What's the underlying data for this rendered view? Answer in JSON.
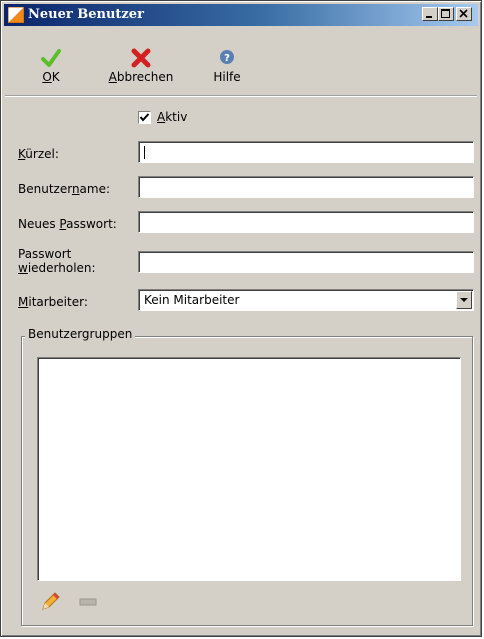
{
  "window": {
    "title": "Neuer Benutzer",
    "minimize_icon": "minimize-icon",
    "maximize_icon": "maximize-icon",
    "close_icon": "close-icon"
  },
  "toolbar": {
    "ok": {
      "label_u": "O",
      "label_rest": "K",
      "icon": "checkmark-icon",
      "color": "#5cbf2a"
    },
    "cancel": {
      "label_u": "A",
      "label_rest": "bbrechen",
      "icon": "red-x-icon",
      "color": "#d42020"
    },
    "help": {
      "label": "Hilfe",
      "icon": "question-icon",
      "color": "#5a7fb5"
    }
  },
  "form": {
    "active": {
      "label_u": "A",
      "label_rest": "ktiv",
      "checked": true
    },
    "kuerzel": {
      "label_u": "K",
      "label_rest": "ürzel:",
      "value": ""
    },
    "username": {
      "label_pre": "Benutzer",
      "label_u": "n",
      "label_rest": "ame:",
      "value": ""
    },
    "new_password": {
      "label_pre": "Neues ",
      "label_u": "P",
      "label_rest": "asswort:",
      "value": ""
    },
    "repeat_password": {
      "label_line1": "Passwort",
      "label_u": "w",
      "label_rest": "iederholen:",
      "value": ""
    },
    "employee": {
      "label_u": "M",
      "label_rest": "itarbeiter:",
      "selected": "Kein Mitarbeiter"
    }
  },
  "groups": {
    "title": "Benutzergruppen",
    "items": [],
    "edit_icon": "pencil-icon",
    "remove_icon": "minus-icon"
  }
}
